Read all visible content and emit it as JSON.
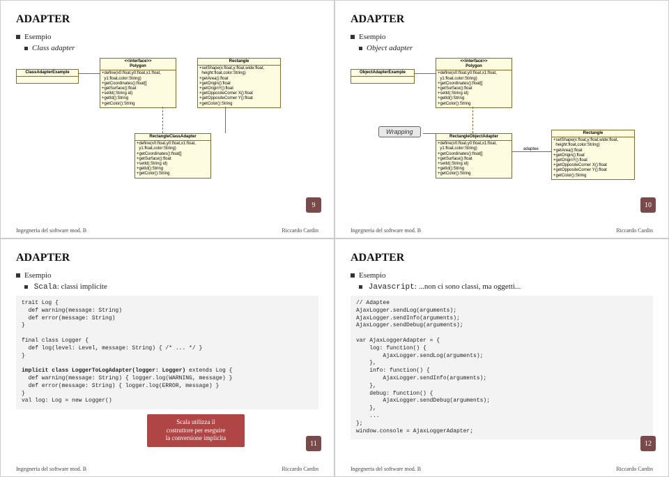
{
  "common": {
    "title": "ADAPTER",
    "esempio": "Esempio",
    "footer_left": "Ingegneria del software mod. B",
    "footer_right": "Riccardo Cardin"
  },
  "slide1": {
    "sub": "Class adapter",
    "page": "9",
    "uml": {
      "classAdapterExample": "ClassAdapterExample",
      "polygon_stereo": "<<interface>>",
      "polygon": "Polygon",
      "polygon_ops": "+define(x0:float,y0:float,x1:float,\n  y1:float,color:String)\n+getCoordinates():float[]\n+getSurface():float\n+setId(:String id)\n+getId():String\n+getColor():String",
      "rectangle": "Rectangle",
      "rectangle_ops": "+setShape(x:float,y:float,wide:float,\n  height:float,color:String)\n+getArea():float\n+getOrigin():float\n+getOriginY():float\n+getOppositeCorner X():float\n+getOppositeCorner Y():float\n+getColor():String",
      "rca": "RectangleClassAdapter",
      "rca_ops": "+define(x0:float,y0:float,x1:float,\n  y1:float,color:String)\n+getCoordinates():float[]\n+getSurface():float\n+setId(:String id)\n+getId():String\n+getColor():String"
    }
  },
  "slide2": {
    "sub": "Object adapter",
    "page": "10",
    "wrapping": "Wrapping",
    "uml": {
      "objectAdapterExample": "ObjectAdapterExample",
      "polygon_stereo": "<<interface>>",
      "polygon": "Polygon",
      "polygon_ops": "+define(x0:float,y0:float,x1:float,\n  y1:float,color:String)\n+getCoordinates():float[]\n+getSurface():float\n+setId(:String id)\n+getId():String\n+getColor():String",
      "roa": "RectangleObjectAdapter",
      "roa_ops": "+define(x0:float,y0:float,x1:float,\n  y1:float,color:String)\n+getCoordinates():float[]\n+getSurface():float\n+setId(:String id)\n+getId():String\n+getColor():String",
      "adaptee": "adaptee",
      "rectangle": "Rectangle",
      "rectangle_ops": "+setShape(x:float,y:float,wide:float,\n  height:float,color:String)\n+getArea():float\n+getOrigin():float\n+getOriginY():float\n+getOppositeCorner X():float\n+getOppositeCorner Y():float\n+getColor():String"
    }
  },
  "slide3": {
    "sub1": "Scala",
    "sub2": ": classi implicite",
    "page": "11",
    "note": "Scala utilizza il\ncostruttore per  eseguire\nla conversione implicita",
    "code": "trait Log {\n  def warning(message: String)\n  def error(message: String)\n}\n\nfinal class Logger {\n  def log(level: Level, message: String) { /* ... */ }\n}\n\nimplicit class LoggerToLogAdapter(logger: Logger) extends Log {\n  def warning(message: String) { logger.log(WARNING, message) }\n  def error(message: String) { logger.log(ERROR, message) }\n}\nval log: Log = new Logger()"
  },
  "slide4": {
    "sub1": "Javascript",
    "sub2": ": ...non ci sono classi, ma oggetti...",
    "page": "12",
    "code": "// Adaptee\nAjaxLogger.sendLog(arguments);\nAjaxLogger.sendInfo(arguments);\nAjaxLogger.sendDebug(arguments);\n\nvar AjaxLoggerAdapter = {\n    log: function() {\n        AjaxLogger.sendLog(arguments);\n    },\n    info: function() {\n        AjaxLogger.sendInfo(arguments);\n    },\n    debug: function() {\n        AjaxLogger.sendDebug(arguments);\n    },\n    ...\n};\nwindow.console = AjaxLoggerAdapter;"
  }
}
